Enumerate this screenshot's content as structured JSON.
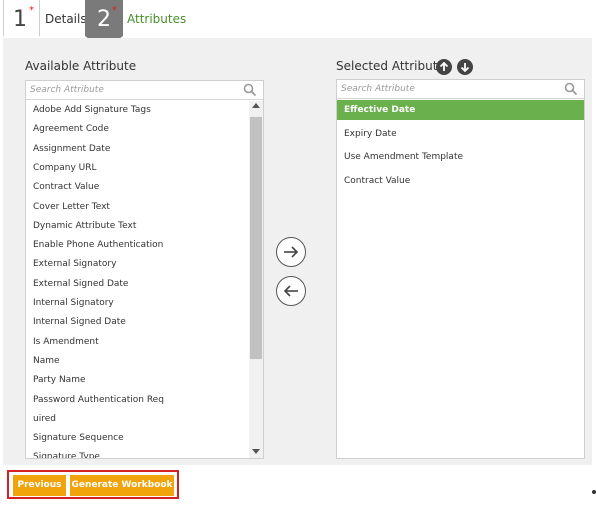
{
  "steps": [
    {
      "number": "1",
      "label": "Details",
      "required_mark": "*"
    },
    {
      "number": "2",
      "label": "Attributes",
      "required_mark": "*"
    }
  ],
  "available": {
    "title": "Available Attribute",
    "search_placeholder": "Search Attribute",
    "items": [
      "Adobe Add Signature Tags",
      "Agreement Code",
      "Assignment Date",
      "Company URL",
      "Contract Value",
      "Cover Letter Text",
      "Dynamic Attribute Text",
      "Enable Phone Authentication",
      "External Signatory",
      "External Signed Date",
      "Internal Signatory",
      "Internal Signed Date",
      "Is Amendment",
      "Name",
      "Party Name",
      "Password Authentication Req",
      "uired",
      "Signature Sequence",
      "Signature Type"
    ]
  },
  "selected": {
    "title": "Selected Attribute",
    "search_placeholder": "Search Attribute",
    "items": [
      "Effective Date",
      "Expiry Date",
      "Use Amendment Template",
      "Contract Value"
    ],
    "highlighted_index": 0
  },
  "actions": {
    "previous_label": "Previous",
    "generate_label": "Generate Workbook"
  },
  "colors": {
    "accent_green": "#6ab04c",
    "button_orange": "#f0a30a",
    "highlight_red": "#d42020"
  }
}
